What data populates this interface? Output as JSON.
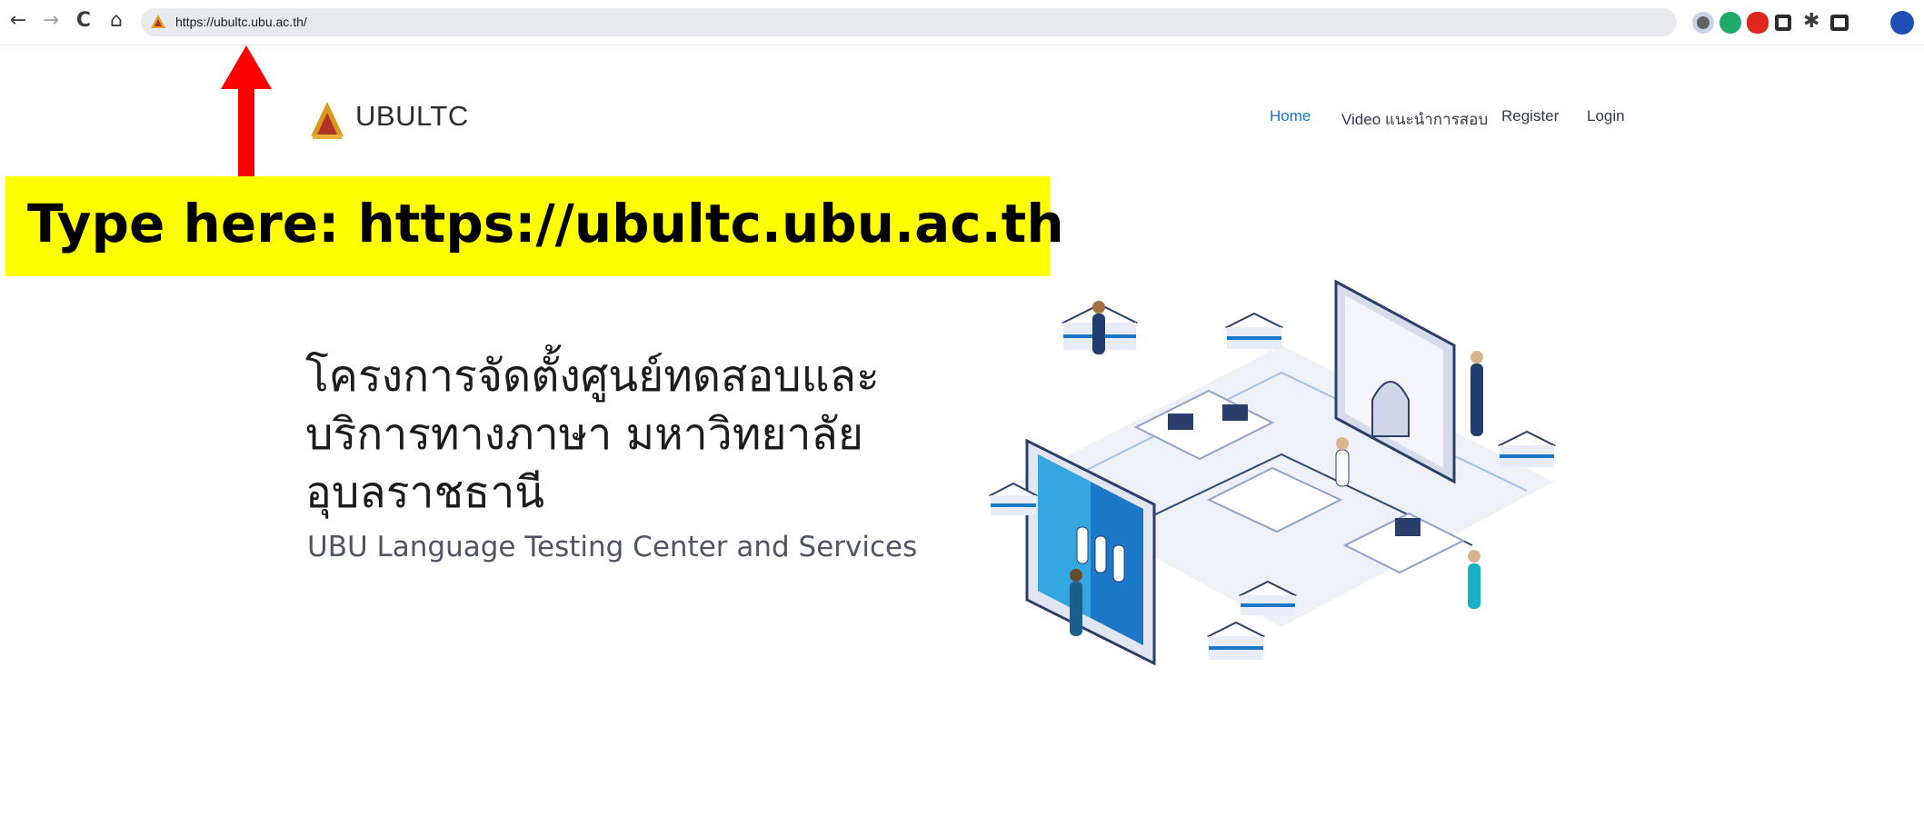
{
  "browser": {
    "back": "←",
    "forward": "→",
    "reload": "C",
    "home": "⌂",
    "url": "https://ubultc.ubu.ac.th/"
  },
  "site": {
    "brand": "UBULTC",
    "nav": [
      "Home",
      "Video แนะนำการสอบ",
      "Register",
      "Login"
    ]
  },
  "annotation": {
    "callout": "Type here: https://ubultc.ubu.ac.th"
  },
  "hero": {
    "title_lines": [
      "โครงการจัดตั้งศูนย์ทดสอบและ",
      "บริการทางภาษา มหาวิทยาลัย",
      "อุบลราชธานี"
    ],
    "subtitle": "UBU Language Testing Center and Services"
  },
  "colors": {
    "accent": "#1a73c8",
    "callout_bg": "#ffff00",
    "arrow": "#ff0000"
  }
}
